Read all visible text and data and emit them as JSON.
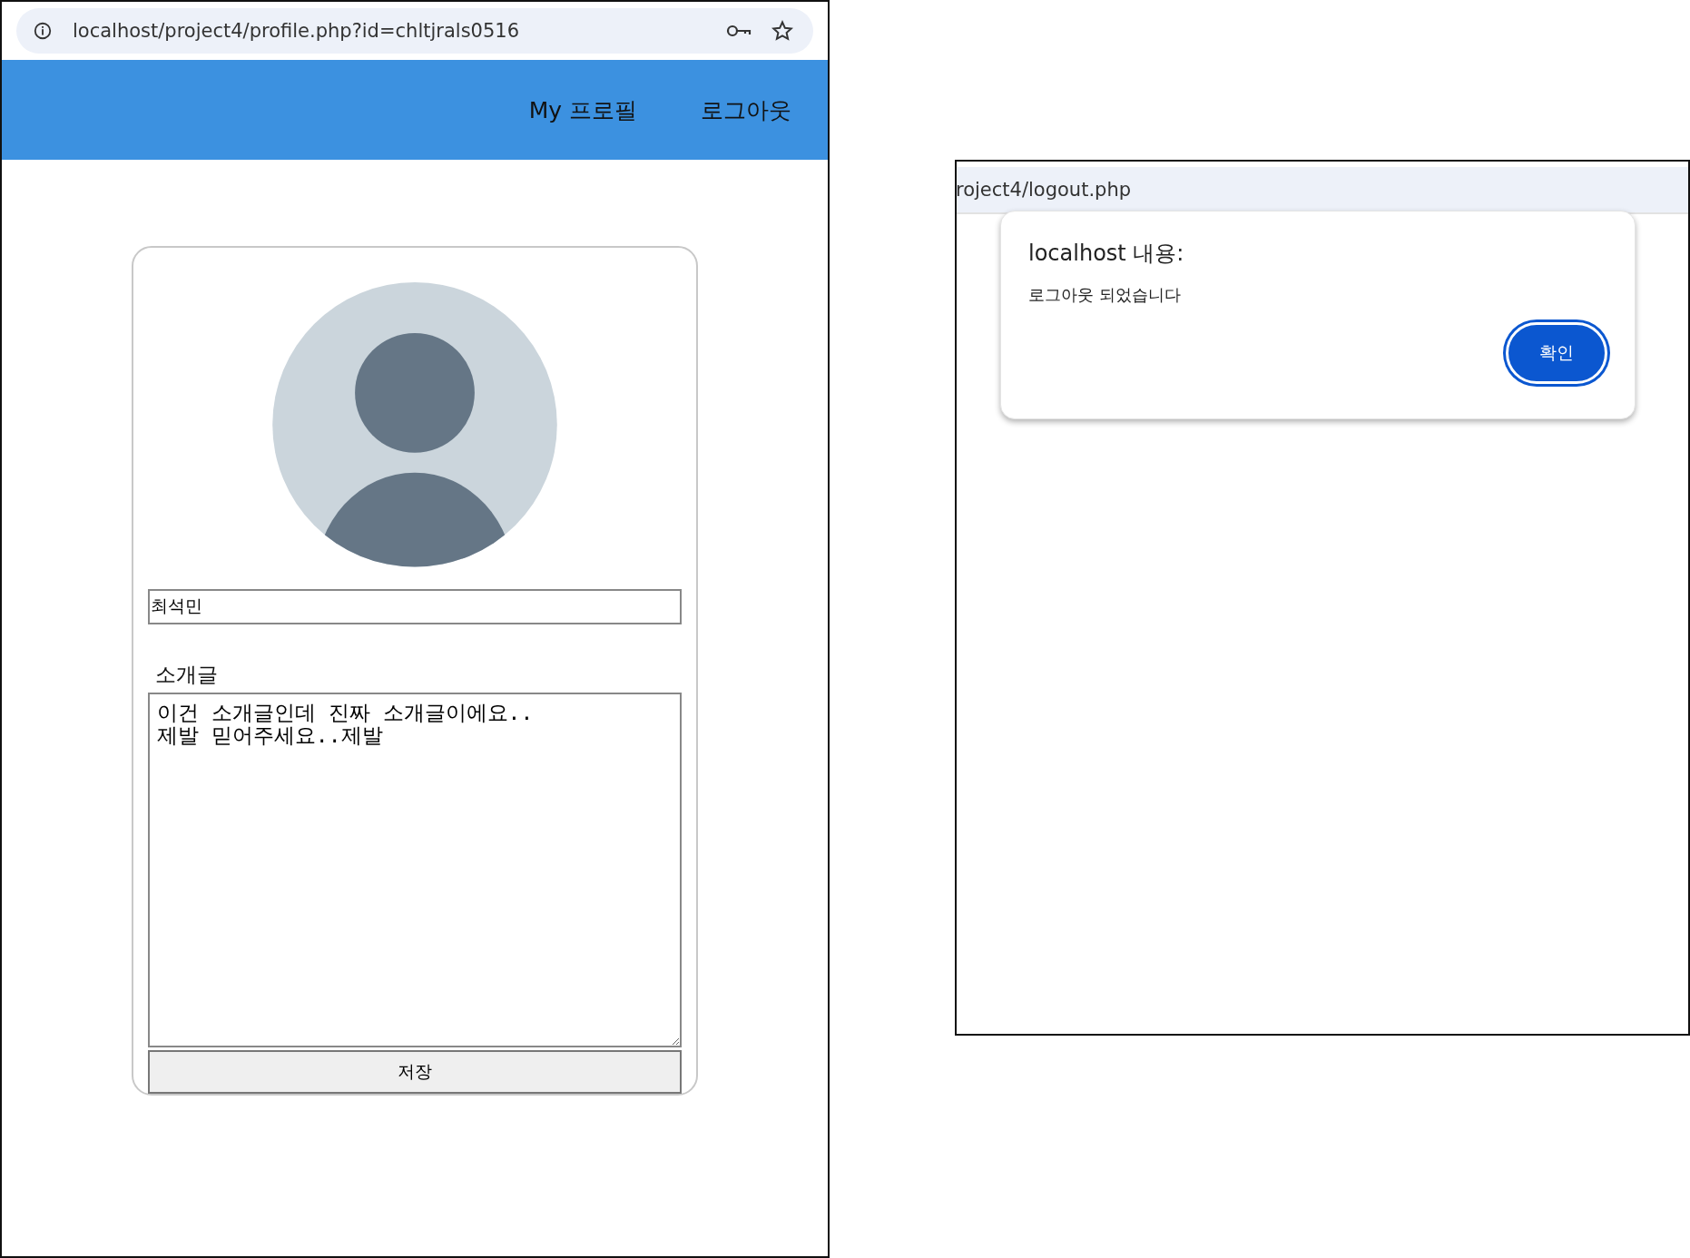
{
  "profile_window": {
    "address_bar": {
      "url": "localhost/project4/profile.php?id=chltjrals0516"
    },
    "nav": [
      {
        "label": "My 프로필"
      },
      {
        "label": "로그아웃"
      }
    ],
    "profile_card": {
      "name_field": {
        "value": "최석민"
      },
      "intro_label": "소개글",
      "intro_field": {
        "value": "이건 소개글인데 진짜 소개글이에요..\n제발 믿어주세요..제발"
      },
      "save_button": "저장"
    }
  },
  "logout_window": {
    "address_bar": {
      "url": "roject4/logout.php"
    },
    "alert": {
      "title": "localhost 내용:",
      "message": "로그아웃 되었습니다",
      "ok_button": "확인"
    }
  }
}
